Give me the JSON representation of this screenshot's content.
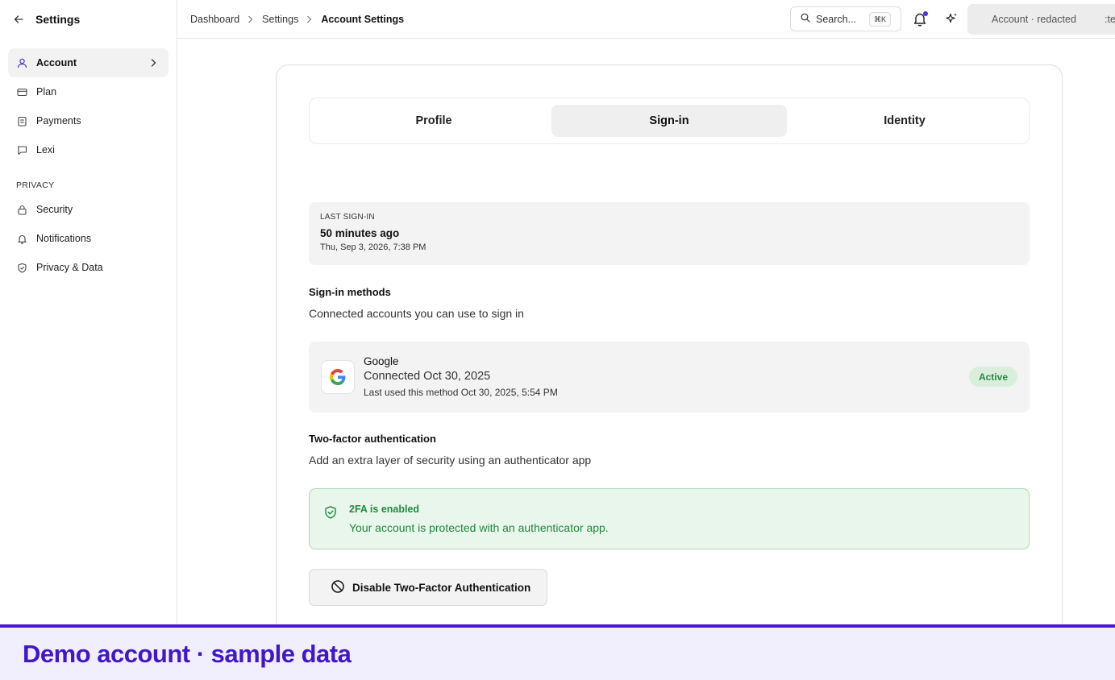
{
  "sidebar": {
    "title": "Settings",
    "items": [
      {
        "label": "Account",
        "icon": "user-icon"
      },
      {
        "label": "Plan",
        "icon": "card-icon"
      },
      {
        "label": "Payments",
        "icon": "receipt-icon"
      },
      {
        "label": "Lexi",
        "icon": "chat-icon"
      }
    ],
    "section_label": "PRIVACY",
    "privacy_items": [
      {
        "label": "Security",
        "icon": "lock-icon"
      },
      {
        "label": "Notifications",
        "icon": "bell-icon"
      },
      {
        "label": "Privacy & Data",
        "icon": "shield-icon"
      }
    ]
  },
  "topbar": {
    "breadcrumbs": [
      "Dashboard",
      "Settings",
      "Account Settings"
    ],
    "search_placeholder": "Search...",
    "search_shortcut": "⌘K",
    "account_label": "Account · redacted",
    "account_tail": ":te"
  },
  "tabs": [
    "Profile",
    "Sign-in",
    "Identity"
  ],
  "active_tab": "Sign-in",
  "last_signin": {
    "label": "LAST SIGN-IN",
    "value": "50 minutes ago",
    "date": "Thu, Sep 3, 2026, 7:38 PM"
  },
  "signin_methods": {
    "title": "Sign-in methods",
    "description": "Connected accounts you can use to sign in",
    "method": {
      "name": "Google",
      "connected": "Connected Oct 30, 2025",
      "last_used": "Last used this method Oct 30, 2025, 5:54 PM",
      "status": "Active"
    }
  },
  "two_factor": {
    "title": "Two-factor authentication",
    "description": "Add an extra layer of security using an authenticator app",
    "status_title": "2FA is enabled",
    "status_desc": "Your account is protected with an authenticator app.",
    "disable_label": "Disable Two-Factor Authentication"
  },
  "banner": {
    "text": "Demo account · sample data"
  },
  "colors": {
    "accent": "#4a17d6",
    "success": "#1f8a3f",
    "success_bg": "#e9f6ec"
  }
}
